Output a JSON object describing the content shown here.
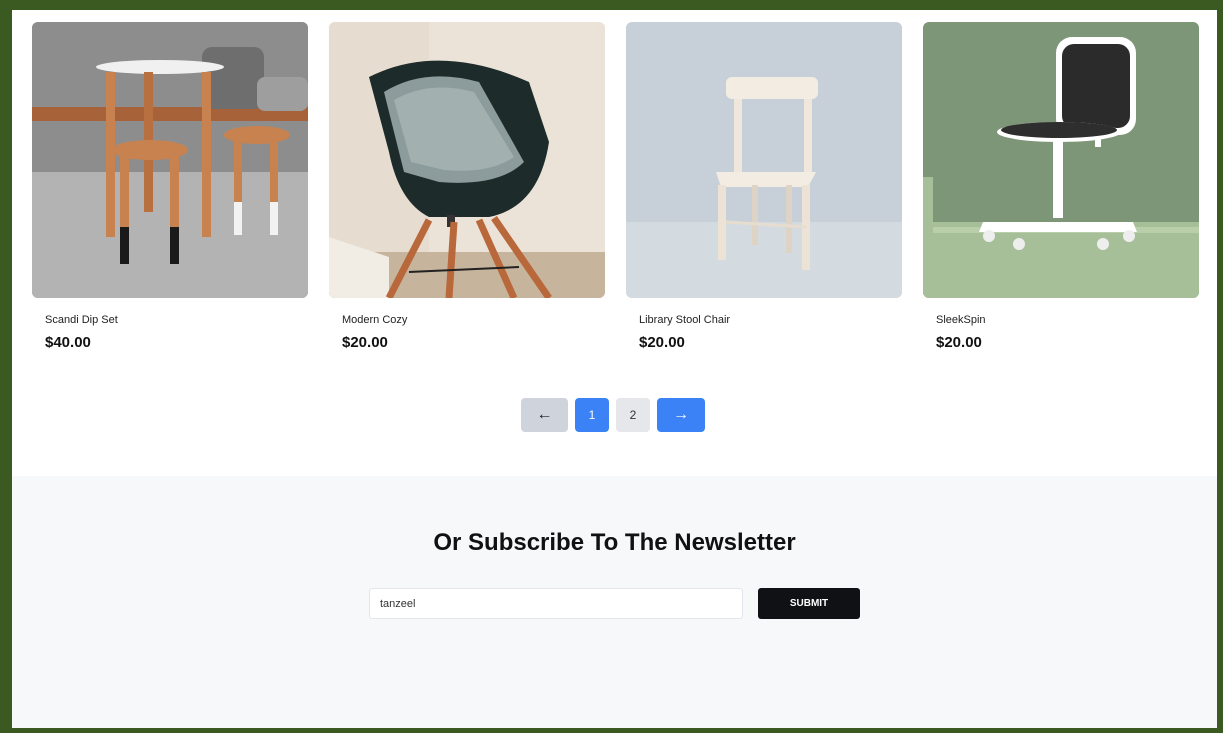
{
  "products": [
    {
      "name": "Scandi Dip Set",
      "price": "$40.00"
    },
    {
      "name": "Modern Cozy",
      "price": "$20.00"
    },
    {
      "name": "Library Stool Chair",
      "price": "$20.00"
    },
    {
      "name": "SleekSpin",
      "price": "$20.00"
    }
  ],
  "pagination": {
    "prev_icon": "arrow-left-icon",
    "pages": [
      "1",
      "2"
    ],
    "current": "1",
    "next_icon": "arrow-right-icon"
  },
  "newsletter": {
    "title": "Or Subscribe To The Newsletter",
    "input_value": "tanzeel",
    "submit_label": "SUBMIT"
  },
  "colors": {
    "frame": "#3a5a22",
    "accent": "#3b82f6",
    "submit": "#0f1114"
  }
}
